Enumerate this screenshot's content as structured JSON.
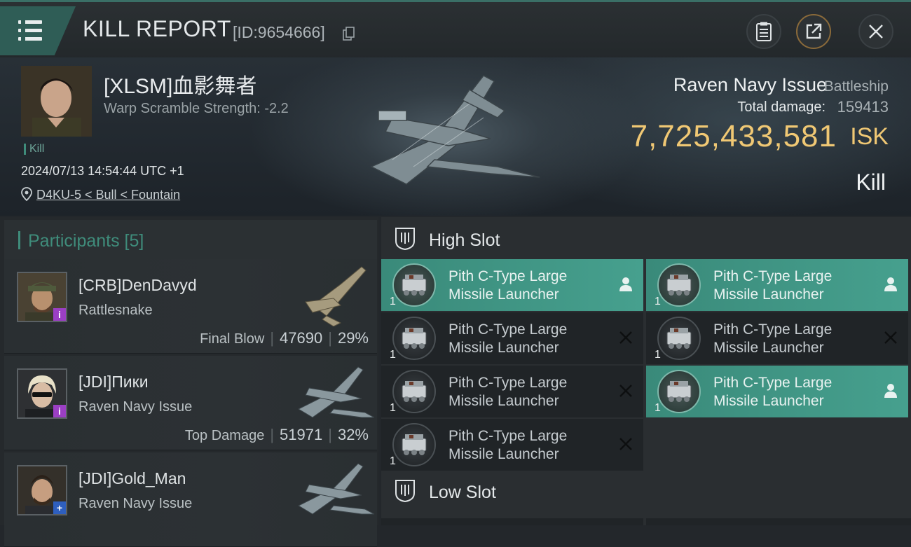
{
  "header": {
    "title": "KILL REPORT",
    "report_id": "[ID:9654666]"
  },
  "victim": {
    "pilot_name": "[XLSM]血影舞者",
    "warp_scramble": "Warp Scramble Strength: -2.2",
    "tag": "Kill",
    "datetime": "2024/07/13 14:54:44 UTC +1",
    "location": "D4KU-5 < Bull < Fountain",
    "ship_name": "Raven Navy Issue",
    "ship_class": "Battleship",
    "total_damage_label": "Total damage:",
    "total_damage": "159413",
    "isk_value": "7,725,433,581",
    "isk_unit": "ISK",
    "result": "Kill"
  },
  "participants": {
    "title": "Participants [5]",
    "rows": [
      {
        "name": "[CRB]DenDavyd",
        "ship": "Rattlesnake",
        "stat_label": "Final Blow",
        "damage": "47690",
        "percent": "29%",
        "badge": "i",
        "badge_color": "#9b3fc4"
      },
      {
        "name": "[JDI]Пики",
        "ship": "Raven Navy Issue",
        "stat_label": "Top Damage",
        "damage": "51971",
        "percent": "32%",
        "badge": "i",
        "badge_color": "#9b3fc4"
      },
      {
        "name": "[JDI]Gold_Man",
        "ship": "Raven Navy Issue",
        "stat_label": "",
        "damage": "",
        "percent": "",
        "badge": "+",
        "badge_color": "#2e5fbf"
      }
    ]
  },
  "slots": {
    "high_title": "High Slot",
    "low_title": "Low Slot",
    "high_modules": [
      {
        "name": "Pith C-Type Large Missile Launcher",
        "qty": "1",
        "state": "fitted"
      },
      {
        "name": "Pith C-Type Large Missile Launcher",
        "qty": "1",
        "state": "fitted"
      },
      {
        "name": "Pith C-Type Large Missile Launcher",
        "qty": "1",
        "state": "destroyed"
      },
      {
        "name": "Pith C-Type Large Missile Launcher",
        "qty": "1",
        "state": "destroyed"
      },
      {
        "name": "Pith C-Type Large Missile Launcher",
        "qty": "1",
        "state": "destroyed"
      },
      {
        "name": "Pith C-Type Large Missile Launcher",
        "qty": "1",
        "state": "fitted"
      },
      {
        "name": "Pith C-Type Large Missile Launcher",
        "qty": "1",
        "state": "destroyed"
      }
    ]
  },
  "colors": {
    "accent": "#3f8c7b",
    "isk": "#f0c874",
    "fitted_row": "#46a08e"
  }
}
